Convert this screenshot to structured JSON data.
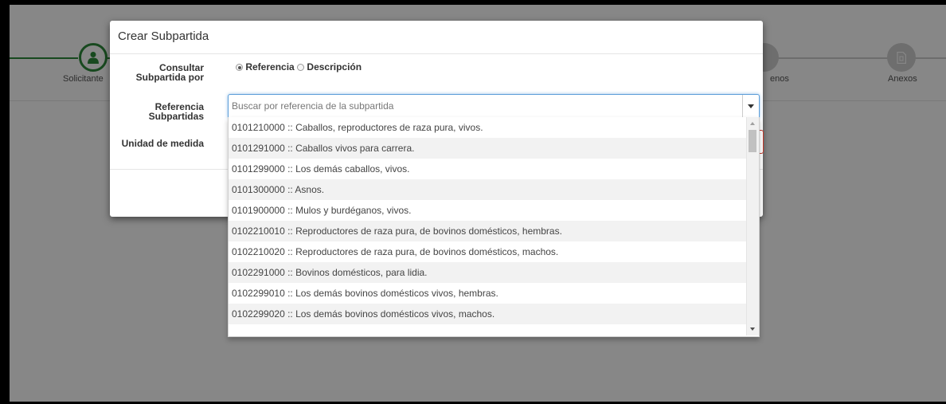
{
  "stepper": {
    "steps": [
      {
        "label": "Solicitante",
        "icon": "user-icon"
      },
      {
        "label": "enos",
        "icon": "step-icon"
      },
      {
        "label": "Anexos",
        "icon": "document-icon"
      }
    ]
  },
  "modal": {
    "title": "Crear Subpartida",
    "consultar_label_line1": "Consultar",
    "consultar_label_line2": "Subpartida por",
    "radio_referencia": "Referencia",
    "radio_descripcion": "Descripción",
    "selected_radio": "Referencia",
    "referencia_label_line1": "Referencia",
    "referencia_label_line2": "Subpartidas",
    "unidad_label": "Unidad de medida"
  },
  "search": {
    "placeholder": "Buscar por referencia de la subpartida"
  },
  "options": [
    "0101210000 :: Caballos, reproductores de raza pura, vivos.",
    "0101291000 :: Caballos vivos para carrera.",
    "0101299000 :: Los demás caballos, vivos.",
    "0101300000 :: Asnos.",
    "0101900000 :: Mulos y burdéganos, vivos.",
    "0102210010 :: Reproductores de raza pura, de bovinos domésticos, hembras.",
    "0102210020 :: Reproductores de raza pura, de bovinos domésticos, machos.",
    "0102291000 :: Bovinos domésticos, para lidia.",
    "0102299010 :: Los demás bovinos domésticos vivos, hembras.",
    "0102299020 :: Los demás bovinos domésticos vivos, machos."
  ],
  "colors": {
    "accent_green": "#2f8a3b",
    "focus_blue": "#5b9dd9",
    "error_red": "#c0392b"
  }
}
